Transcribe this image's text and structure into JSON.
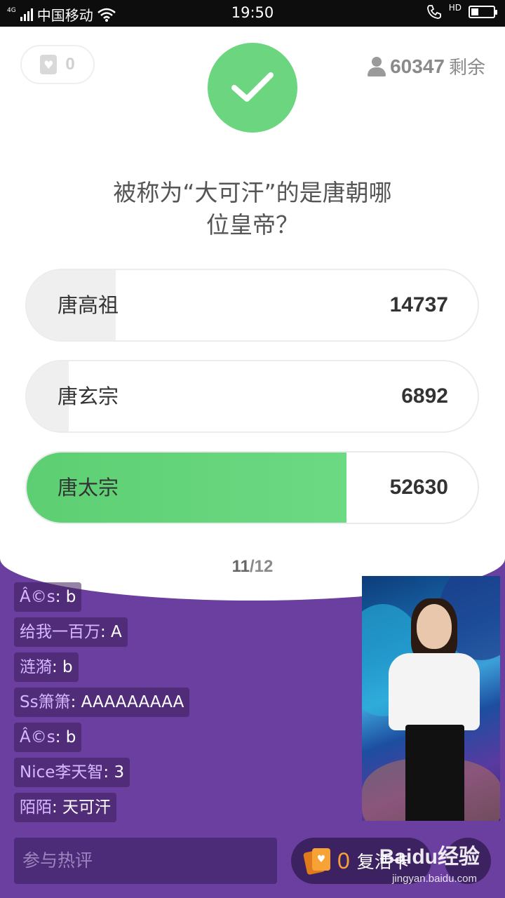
{
  "status_bar": {
    "network": "4G",
    "carrier": "中国移动",
    "time": "19:50",
    "hd": "HD"
  },
  "header": {
    "life_count": "0",
    "remaining_count": "60347",
    "remaining_label": "剩余"
  },
  "question": {
    "text": "被称为“大可汗”的是唐朝哪位皇帝？"
  },
  "options": [
    {
      "label": "唐高祖",
      "count": "14737",
      "share": 0.198,
      "correct": false
    },
    {
      "label": "唐玄宗",
      "count": "6892",
      "share": 0.093,
      "correct": false
    },
    {
      "label": "唐太宗",
      "count": "52630",
      "share": 0.709,
      "correct": true
    }
  ],
  "progress": {
    "current": "11",
    "total": "/12"
  },
  "comments": [
    {
      "user": "Â©s",
      "text": ": b"
    },
    {
      "user": "给我一百万",
      "text": ": A"
    },
    {
      "user": "涟漪",
      "text": ": b"
    },
    {
      "user": "Ss箫箫",
      "text": ": AAAAAAAAA"
    },
    {
      "user": "Â©s",
      "text": ": b"
    },
    {
      "user": "Nice李天智",
      "text": ": 3"
    },
    {
      "user": "陌陌",
      "text": ": 天可汗"
    }
  ],
  "bottom": {
    "comment_placeholder": "参与热评",
    "revive_count": "0",
    "revive_label": "复活卡"
  },
  "watermark": {
    "logo": "Baidu经验",
    "url": "jingyan.baidu.com"
  },
  "colors": {
    "correct_green": "#6cd57f",
    "background_purple": "#6b3fa0",
    "revive_orange": "#f7a234"
  }
}
